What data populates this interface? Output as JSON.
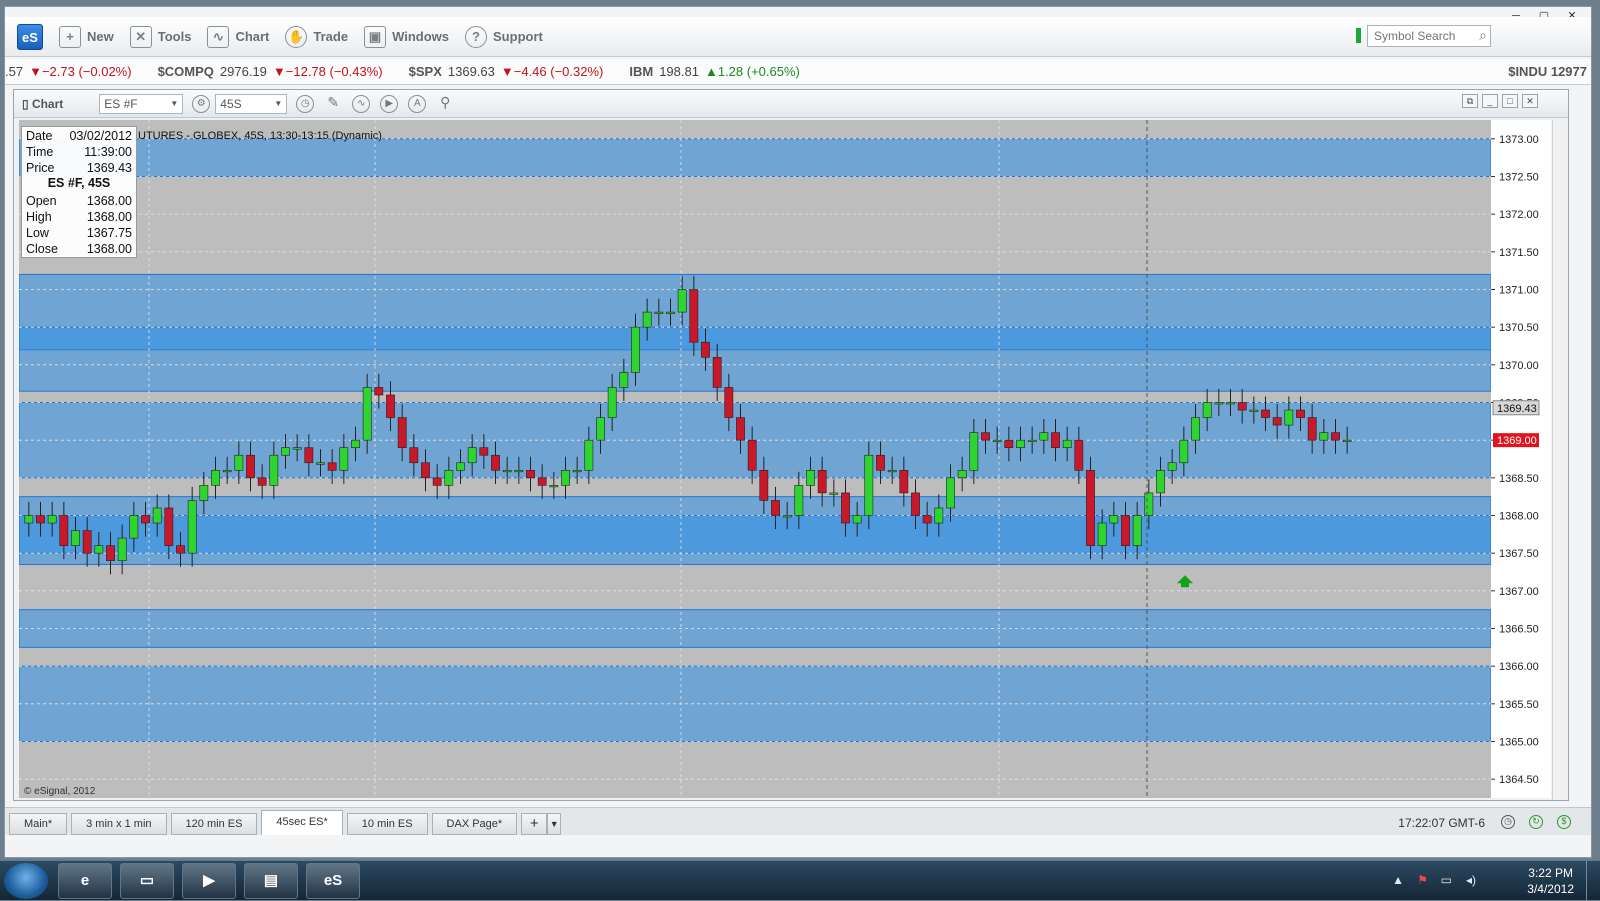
{
  "toolbar": {
    "items": [
      {
        "label": "New",
        "icon": "new-doc-icon"
      },
      {
        "label": "Tools",
        "icon": "tools-icon"
      },
      {
        "label": "Chart",
        "icon": "chart-icon"
      },
      {
        "label": "Trade",
        "icon": "trade-icon"
      },
      {
        "label": "Windows",
        "icon": "windows-icon"
      },
      {
        "label": "Support",
        "icon": "help-icon"
      }
    ],
    "logo": "eS",
    "symbol_search_placeholder": "Symbol Search"
  },
  "ticker": {
    "lead_value": ".57",
    "lead_change": "▼−2.73 (−0.02%)",
    "items": [
      {
        "symbol": "$COMPQ",
        "price": "2976.19",
        "change": "▼−12.78 (−0.43%)",
        "dir": "down"
      },
      {
        "symbol": "$SPX",
        "price": "1369.63",
        "change": "▼−4.46 (−0.32%)",
        "dir": "down"
      },
      {
        "symbol": "IBM",
        "price": "198.81",
        "change": "▲1.28 (+0.65%)",
        "dir": "up"
      }
    ],
    "right": "$INDU  12977"
  },
  "chart": {
    "panel_title": "Chart",
    "symbol_field": "ES #F",
    "interval_field": "45S",
    "label": "UTURES - GLOBEX, 45S, 13:30-13:15 (Dynamic)",
    "copyright": "© eSignal, 2012",
    "data_window": {
      "date_label": "Date",
      "date": "03/02/2012",
      "time_label": "Time",
      "time": "11:39:00",
      "price_label": "Price",
      "price": "1369.43",
      "heading": "ES #F, 45S",
      "open_label": "Open",
      "open": "1368.00",
      "high_label": "High",
      "high": "1368.00",
      "low_label": "Low",
      "low": "1367.75",
      "close_label": "Close",
      "close": "1368.00"
    }
  },
  "chart_data": {
    "type": "candlestick",
    "y_ticks": [
      "1373.00",
      "1372.50",
      "1372.00",
      "1371.50",
      "1371.00",
      "1370.50",
      "1370.00",
      "1369.50",
      "1369.00",
      "1368.50",
      "1368.00",
      "1367.50",
      "1367.00",
      "1366.50",
      "1366.00",
      "1365.50",
      "1365.00",
      "1364.50"
    ],
    "ylim": [
      1364.25,
      1373.25
    ],
    "cursor_price": "1369.43",
    "last_price": "1369.00",
    "colors": {
      "up": "#2ed52e",
      "down": "#c8182a",
      "band": "#2f8fe6",
      "background": "#bdbdbd"
    },
    "zones": [
      {
        "lo": 1372.5,
        "hi": 1373.0
      },
      {
        "lo": 1370.2,
        "hi": 1371.2
      },
      {
        "lo": 1369.65,
        "hi": 1370.5
      },
      {
        "lo": 1368.5,
        "hi": 1369.5
      },
      {
        "lo": 1367.5,
        "hi": 1368.25
      },
      {
        "lo": 1367.35,
        "hi": 1368.0
      },
      {
        "lo": 1366.25,
        "hi": 1366.75
      },
      {
        "lo": 1365.0,
        "hi": 1366.0
      }
    ],
    "closes": [
      1368.0,
      1367.9,
      1368.0,
      1367.6,
      1367.8,
      1367.5,
      1367.6,
      1367.4,
      1367.7,
      1368.0,
      1367.9,
      1368.1,
      1367.6,
      1367.5,
      1368.2,
      1368.4,
      1368.6,
      1368.6,
      1368.8,
      1368.5,
      1368.4,
      1368.8,
      1368.9,
      1368.9,
      1368.7,
      1368.7,
      1368.6,
      1368.9,
      1369.0,
      1369.7,
      1369.6,
      1369.3,
      1368.9,
      1368.7,
      1368.5,
      1368.4,
      1368.6,
      1368.7,
      1368.9,
      1368.8,
      1368.6,
      1368.6,
      1368.6,
      1368.5,
      1368.4,
      1368.4,
      1368.6,
      1368.6,
      1369.0,
      1369.3,
      1369.7,
      1369.9,
      1370.5,
      1370.7,
      1370.7,
      1370.7,
      1371.0,
      1370.3,
      1370.1,
      1369.7,
      1369.3,
      1369.0,
      1368.6,
      1368.2,
      1368.0,
      1368.0,
      1368.4,
      1368.6,
      1368.3,
      1368.3,
      1367.9,
      1368.0,
      1368.8,
      1368.6,
      1368.6,
      1368.3,
      1368.0,
      1367.9,
      1368.1,
      1368.5,
      1368.6,
      1369.1,
      1369.0,
      1369.0,
      1368.9,
      1369.0,
      1369.0,
      1369.1,
      1368.9,
      1369.0,
      1368.6,
      1367.6,
      1367.9,
      1368.0,
      1367.6,
      1368.0,
      1368.3,
      1368.6,
      1368.7,
      1369.0,
      1369.3,
      1369.5,
      1369.5,
      1369.5,
      1369.4,
      1369.4,
      1369.3,
      1369.2,
      1369.4,
      1369.3,
      1369.0,
      1369.1,
      1369.0,
      1369.0
    ],
    "buy_signal_price": 1367.1
  },
  "tabs": [
    "Main*",
    "3 min x 1 min",
    "120 min ES",
    "45sec ES*",
    "10 min ES",
    "DAX Page*"
  ],
  "active_tab": "45sec ES*",
  "status": {
    "clock": "17:22:07 GMT-6"
  },
  "taskbar": {
    "time": "3:22 PM",
    "date": "3/4/2012",
    "apps": [
      {
        "name": "ie-icon",
        "glyph": "e"
      },
      {
        "name": "folder-icon",
        "glyph": "▭"
      },
      {
        "name": "media-icon",
        "glyph": "▶"
      },
      {
        "name": "network-icon",
        "glyph": "▤"
      },
      {
        "name": "esignal-icon",
        "glyph": "eS"
      }
    ]
  }
}
